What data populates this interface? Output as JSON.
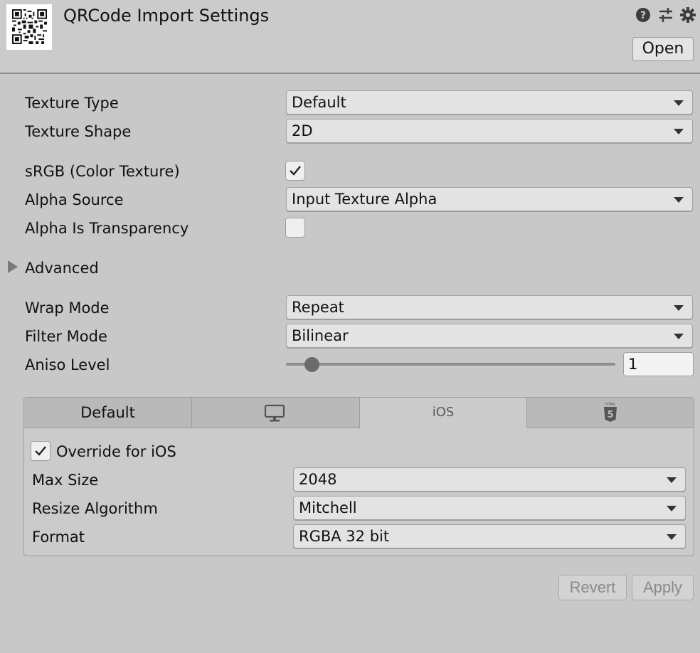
{
  "header": {
    "title": "QRCode Import Settings",
    "icons": [
      "help-icon",
      "presets-icon",
      "gear-icon"
    ],
    "open_label": "Open"
  },
  "settings": {
    "texture_type": {
      "label": "Texture Type",
      "value": "Default"
    },
    "texture_shape": {
      "label": "Texture Shape",
      "value": "2D"
    },
    "srgb": {
      "label": "sRGB (Color Texture)",
      "checked": true
    },
    "alpha_source": {
      "label": "Alpha Source",
      "value": "Input Texture Alpha"
    },
    "alpha_is_transparency": {
      "label": "Alpha Is Transparency",
      "checked": false
    },
    "advanced": {
      "label": "Advanced",
      "expanded": false
    },
    "wrap_mode": {
      "label": "Wrap Mode",
      "value": "Repeat"
    },
    "filter_mode": {
      "label": "Filter Mode",
      "value": "Bilinear"
    },
    "aniso_level": {
      "label": "Aniso Level",
      "value": "1",
      "slider_fraction": 0.07
    }
  },
  "platform": {
    "tabs": [
      {
        "label": "Default",
        "icon": null,
        "active": false
      },
      {
        "label": "",
        "icon": "monitor-icon",
        "active": false
      },
      {
        "label": "iOS",
        "icon": null,
        "active": true
      },
      {
        "label": "",
        "icon": "html5-icon",
        "active": false
      }
    ],
    "override": {
      "label": "Override for iOS",
      "checked": true
    },
    "max_size": {
      "label": "Max Size",
      "value": "2048"
    },
    "resize_algorithm": {
      "label": "Resize Algorithm",
      "value": "Mitchell"
    },
    "format": {
      "label": "Format",
      "value": "RGBA 32 bit"
    }
  },
  "footer": {
    "revert_label": "Revert",
    "apply_label": "Apply"
  }
}
